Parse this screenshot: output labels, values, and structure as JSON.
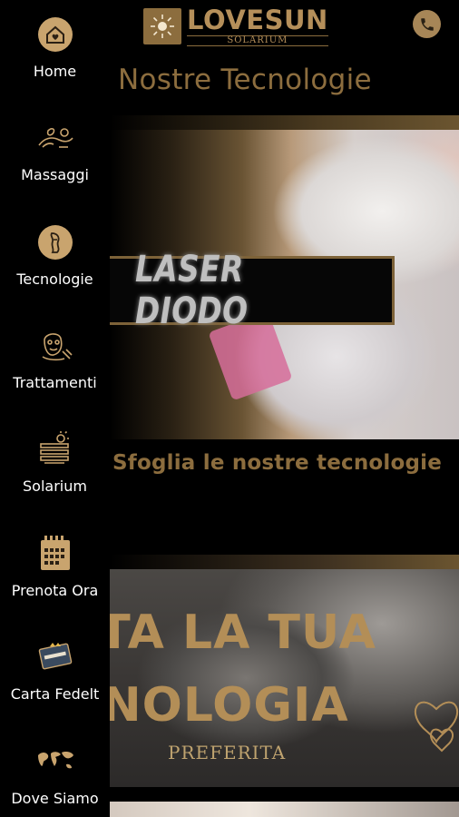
{
  "header": {
    "logo_title": "LOVESUN",
    "logo_subtitle": "SOLARIUM"
  },
  "page_title": "Nostre Tecnologie",
  "hero": {
    "label": "LASER DIODO",
    "caption": "Sfoglia le nostre tecnologie"
  },
  "banner2": {
    "line1": "OTA LA TUA",
    "line2": "CNOLOGIA",
    "line3": "PREFERITA"
  },
  "sidebar": {
    "items": [
      {
        "label": "Home",
        "icon": "home-icon"
      },
      {
        "label": "Massaggi",
        "icon": "massage-icon"
      },
      {
        "label": "Tecnologie",
        "icon": "technology-icon"
      },
      {
        "label": "Trattamenti",
        "icon": "treatment-icon"
      },
      {
        "label": "Solarium",
        "icon": "solarium-icon"
      },
      {
        "label": "Prenota Ora",
        "icon": "calendar-icon"
      },
      {
        "label": "Carta Fedelt",
        "icon": "loyalty-card-icon"
      },
      {
        "label": "Dove Siamo",
        "icon": "world-map-icon"
      }
    ]
  },
  "colors": {
    "accent": "#b58f5a",
    "background": "#000000",
    "nav_text": "#ffffff"
  }
}
